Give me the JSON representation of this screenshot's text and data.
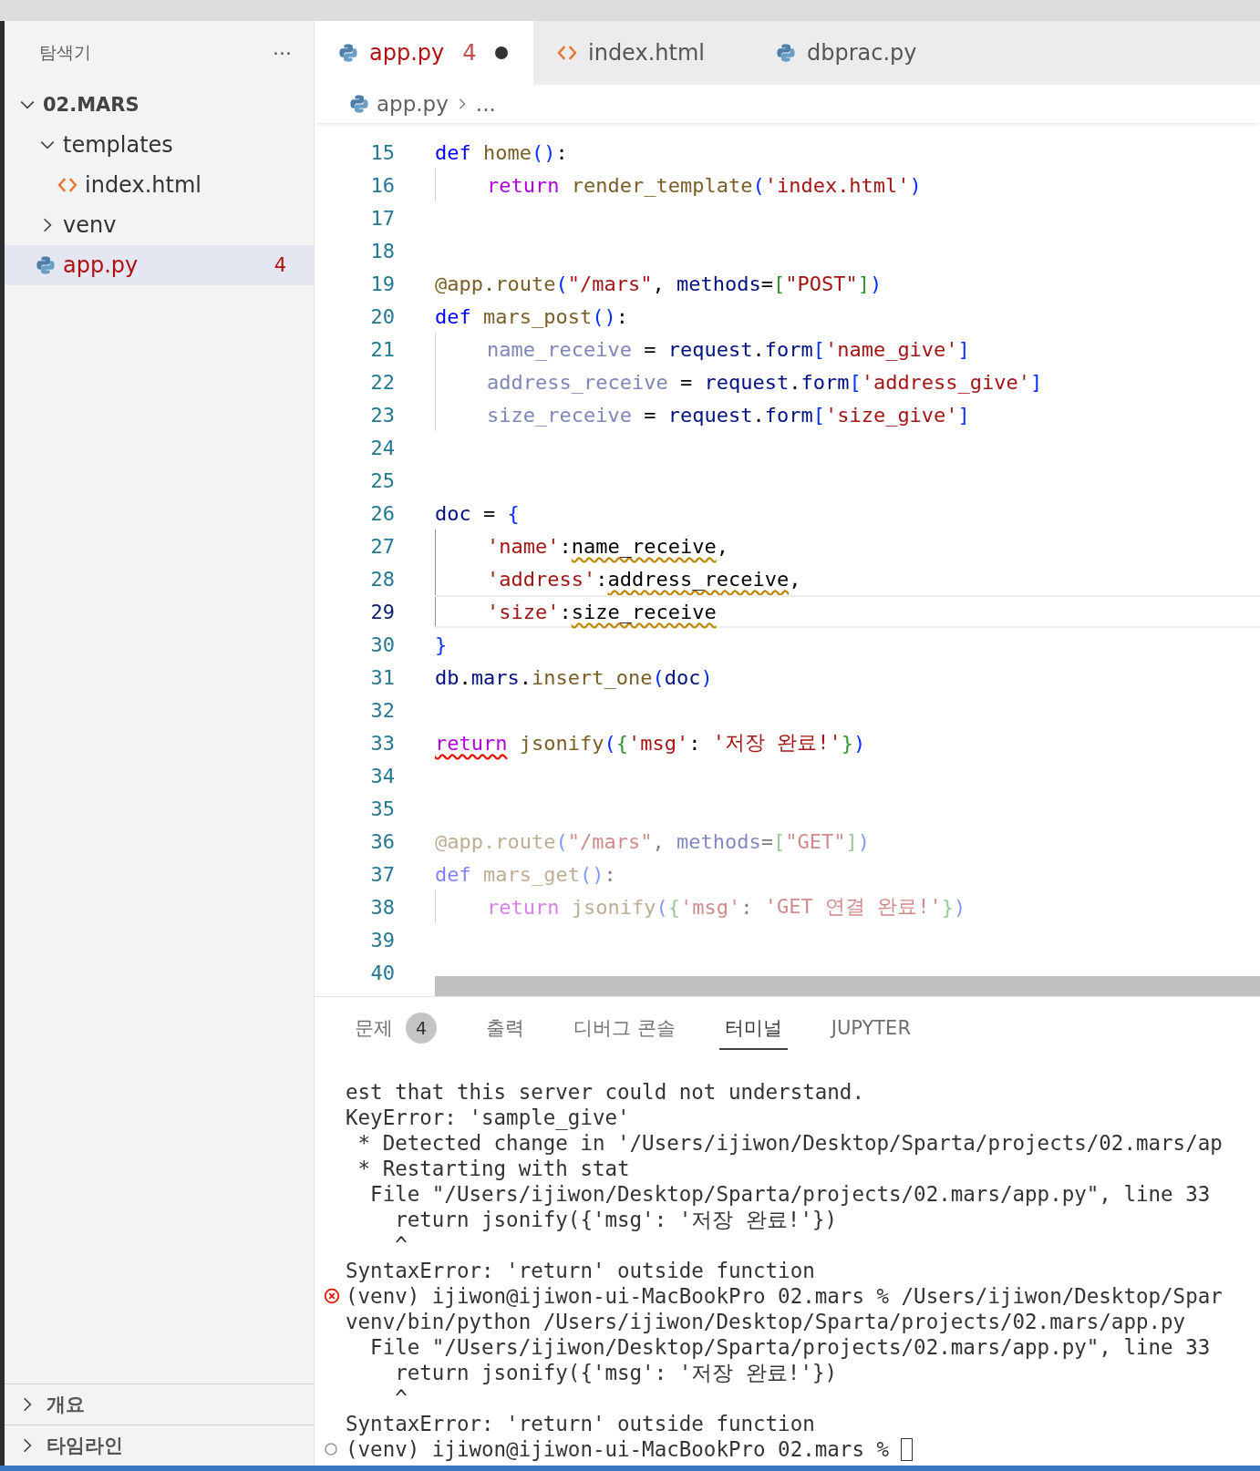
{
  "sidebar": {
    "title": "탐색기",
    "more": "···",
    "folder": {
      "name": "02.MARS",
      "expanded": true
    },
    "tree": [
      {
        "name": "templates",
        "kind": "folder",
        "expanded": true,
        "selected": false,
        "children": [
          {
            "name": "index.html",
            "kind": "html",
            "selected": false
          }
        ]
      },
      {
        "name": "venv",
        "kind": "folder",
        "expanded": false,
        "selected": false
      },
      {
        "name": "app.py",
        "kind": "python",
        "selected": true,
        "error": true,
        "badge": "4"
      }
    ],
    "sections": [
      {
        "name": "개요",
        "expanded": false
      },
      {
        "name": "타임라인",
        "expanded": false
      }
    ]
  },
  "tabs": [
    {
      "label": "app.py",
      "kind": "python",
      "selected": true,
      "error": true,
      "badge": "4",
      "modified": true
    },
    {
      "label": "index.html",
      "kind": "html",
      "selected": false,
      "error": false,
      "modified": false
    },
    {
      "label": "dbprac.py",
      "kind": "python",
      "selected": false,
      "error": false,
      "modified": false
    }
  ],
  "breadcrumb": {
    "file": "app.py",
    "rest": "..."
  },
  "code_lines": [
    {
      "number": "15",
      "current": false,
      "faded": false,
      "tokens": [
        {
          "text": "def ",
          "kind": "keyword"
        },
        {
          "text": "home",
          "kind": "function"
        },
        {
          "text": "()",
          "kind": "bracket"
        },
        {
          "text": ":",
          "kind": "plain"
        }
      ]
    },
    {
      "number": "16",
      "current": false,
      "faded": false,
      "indented": true,
      "guide_active": false,
      "tokens": [
        {
          "text": "return ",
          "kind": "control"
        },
        {
          "text": "render_template",
          "kind": "function"
        },
        {
          "text": "(",
          "kind": "bracket"
        },
        {
          "text": "'index.html'",
          "kind": "string"
        },
        {
          "text": ")",
          "kind": "bracket"
        }
      ]
    },
    {
      "number": "17",
      "current": false
    },
    {
      "number": "18",
      "current": false
    },
    {
      "number": "19",
      "current": false,
      "faded": false,
      "tokens": [
        {
          "text": "@app.",
          "kind": "decorator"
        },
        {
          "text": "route",
          "kind": "function"
        },
        {
          "text": "(",
          "kind": "bracket"
        },
        {
          "text": "\"/mars\"",
          "kind": "string"
        },
        {
          "text": ", ",
          "kind": "plain"
        },
        {
          "text": "methods",
          "kind": "name"
        },
        {
          "text": "=",
          "kind": "plain"
        },
        {
          "text": "[",
          "kind": "bracket2"
        },
        {
          "text": "\"POST\"",
          "kind": "string"
        },
        {
          "text": "]",
          "kind": "bracket2"
        },
        {
          "text": ")",
          "kind": "bracket"
        }
      ]
    },
    {
      "number": "20",
      "current": false,
      "faded": false,
      "tokens": [
        {
          "text": "def ",
          "kind": "keyword"
        },
        {
          "text": "mars_post",
          "kind": "function"
        },
        {
          "text": "()",
          "kind": "bracket"
        },
        {
          "text": ":",
          "kind": "plain"
        }
      ]
    },
    {
      "number": "21",
      "current": false,
      "faded": false,
      "indented": true,
      "guide_active": false,
      "tokens": [
        {
          "text": "name_receive",
          "kind": "unused"
        },
        {
          "text": " = ",
          "kind": "plain"
        },
        {
          "text": "request",
          "kind": "name"
        },
        {
          "text": ".",
          "kind": "plain"
        },
        {
          "text": "form",
          "kind": "name"
        },
        {
          "text": "[",
          "kind": "bracket"
        },
        {
          "text": "'name_give'",
          "kind": "string"
        },
        {
          "text": "]",
          "kind": "bracket"
        }
      ]
    },
    {
      "number": "22",
      "current": false,
      "faded": false,
      "indented": true,
      "guide_active": false,
      "tokens": [
        {
          "text": "address_receive",
          "kind": "unused"
        },
        {
          "text": " = ",
          "kind": "plain"
        },
        {
          "text": "request",
          "kind": "name"
        },
        {
          "text": ".",
          "kind": "plain"
        },
        {
          "text": "form",
          "kind": "name"
        },
        {
          "text": "[",
          "kind": "bracket"
        },
        {
          "text": "'address_give'",
          "kind": "string"
        },
        {
          "text": "]",
          "kind": "bracket"
        }
      ]
    },
    {
      "number": "23",
      "current": false,
      "faded": false,
      "indented": true,
      "guide_active": false,
      "tokens": [
        {
          "text": "size_receive",
          "kind": "unused"
        },
        {
          "text": " = ",
          "kind": "plain"
        },
        {
          "text": "request",
          "kind": "name"
        },
        {
          "text": ".",
          "kind": "plain"
        },
        {
          "text": "form",
          "kind": "name"
        },
        {
          "text": "[",
          "kind": "bracket"
        },
        {
          "text": "'size_give'",
          "kind": "string"
        },
        {
          "text": "]",
          "kind": "bracket"
        }
      ]
    },
    {
      "number": "24",
      "current": false
    },
    {
      "number": "25",
      "current": false
    },
    {
      "number": "26",
      "current": false,
      "faded": false,
      "tokens": [
        {
          "text": "doc",
          "kind": "name"
        },
        {
          "text": " = ",
          "kind": "plain"
        },
        {
          "text": "{",
          "kind": "bracket"
        }
      ]
    },
    {
      "number": "27",
      "current": false,
      "faded": false,
      "indented": true,
      "guide_active": true,
      "tokens": [
        {
          "text": "'name'",
          "kind": "string"
        },
        {
          "text": ":",
          "kind": "plain"
        },
        {
          "text": "name_receive",
          "kind": "plain",
          "warning": true
        },
        {
          "text": ",",
          "kind": "plain"
        }
      ]
    },
    {
      "number": "28",
      "current": false,
      "faded": false,
      "indented": true,
      "guide_active": true,
      "tokens": [
        {
          "text": "'address'",
          "kind": "string"
        },
        {
          "text": ":",
          "kind": "plain"
        },
        {
          "text": "address_receive",
          "kind": "plain",
          "warning": true
        },
        {
          "text": ",",
          "kind": "plain"
        }
      ]
    },
    {
      "number": "29",
      "current": true,
      "faded": false,
      "indented": true,
      "guide_active": true,
      "tokens": [
        {
          "text": "'size'",
          "kind": "string"
        },
        {
          "text": ":",
          "kind": "plain"
        },
        {
          "text": "size_receive",
          "kind": "plain",
          "warning": true
        }
      ]
    },
    {
      "number": "30",
      "current": false,
      "faded": false,
      "tokens": [
        {
          "text": "}",
          "kind": "bracket"
        }
      ]
    },
    {
      "number": "31",
      "current": false,
      "faded": false,
      "tokens": [
        {
          "text": "db",
          "kind": "name"
        },
        {
          "text": ".",
          "kind": "plain"
        },
        {
          "text": "mars",
          "kind": "name"
        },
        {
          "text": ".",
          "kind": "plain"
        },
        {
          "text": "insert_one",
          "kind": "function"
        },
        {
          "text": "(",
          "kind": "bracket"
        },
        {
          "text": "doc",
          "kind": "name"
        },
        {
          "text": ")",
          "kind": "bracket"
        }
      ]
    },
    {
      "number": "32",
      "current": false
    },
    {
      "number": "33",
      "current": false,
      "faded": false,
      "tokens": [
        {
          "text": "return",
          "kind": "control",
          "error": true
        },
        {
          "text": " jsonify",
          "kind": "function"
        },
        {
          "text": "(",
          "kind": "bracket"
        },
        {
          "text": "{",
          "kind": "bracket2"
        },
        {
          "text": "'msg'",
          "kind": "string"
        },
        {
          "text": ": ",
          "kind": "plain"
        },
        {
          "text": "'저장 완료!'",
          "kind": "string"
        },
        {
          "text": "}",
          "kind": "bracket2"
        },
        {
          "text": ")",
          "kind": "bracket"
        }
      ]
    },
    {
      "number": "34",
      "current": false
    },
    {
      "number": "35",
      "current": false
    },
    {
      "number": "36",
      "current": false,
      "faded": true,
      "tokens": [
        {
          "text": "@app.",
          "kind": "decorator"
        },
        {
          "text": "route",
          "kind": "function"
        },
        {
          "text": "(",
          "kind": "bracket"
        },
        {
          "text": "\"/mars\"",
          "kind": "string"
        },
        {
          "text": ", ",
          "kind": "plain"
        },
        {
          "text": "methods",
          "kind": "name"
        },
        {
          "text": "=",
          "kind": "plain"
        },
        {
          "text": "[",
          "kind": "bracket2"
        },
        {
          "text": "\"GET\"",
          "kind": "string"
        },
        {
          "text": "]",
          "kind": "bracket2"
        },
        {
          "text": ")",
          "kind": "bracket"
        }
      ]
    },
    {
      "number": "37",
      "current": false,
      "faded": true,
      "tokens": [
        {
          "text": "def ",
          "kind": "keyword"
        },
        {
          "text": "mars_get",
          "kind": "function"
        },
        {
          "text": "()",
          "kind": "bracket"
        },
        {
          "text": ":",
          "kind": "plain"
        }
      ]
    },
    {
      "number": "38",
      "current": false,
      "faded": true,
      "indented": true,
      "guide_active": false,
      "tokens": [
        {
          "text": "return ",
          "kind": "control"
        },
        {
          "text": "jsonify",
          "kind": "function"
        },
        {
          "text": "(",
          "kind": "bracket"
        },
        {
          "text": "{",
          "kind": "bracket2"
        },
        {
          "text": "'msg'",
          "kind": "string"
        },
        {
          "text": ": ",
          "kind": "plain"
        },
        {
          "text": "'GET 연결 완료!'",
          "kind": "string"
        },
        {
          "text": "}",
          "kind": "bracket2"
        },
        {
          "text": ")",
          "kind": "bracket"
        }
      ]
    },
    {
      "number": "39",
      "current": false
    },
    {
      "number": "40",
      "current": false
    }
  ],
  "panel": {
    "tabs": [
      {
        "label": "문제",
        "selected": false,
        "badge": "4"
      },
      {
        "label": "출력",
        "selected": false
      },
      {
        "label": "디버그 콘솔",
        "selected": false
      },
      {
        "label": "터미널",
        "selected": true
      },
      {
        "label": "JUPYTER",
        "selected": false
      }
    ],
    "terminal": [
      {
        "text": "est that this server could not understand.",
        "kind": "output"
      },
      {
        "text": "KeyError: 'sample_give'",
        "kind": "output"
      },
      {
        "text": " * Detected change in '/Users/ijiwon/Desktop/Sparta/projects/02.mars/ap",
        "kind": "output"
      },
      {
        "text": " * Restarting with stat",
        "kind": "output"
      },
      {
        "text": "  File \"/Users/ijiwon/Desktop/Sparta/projects/02.mars/app.py\", line 33",
        "kind": "output"
      },
      {
        "text": "    return jsonify({'msg': '저장 완료!'})",
        "kind": "output"
      },
      {
        "text": "    ^",
        "kind": "output"
      },
      {
        "text": "SyntaxError: 'return' outside function",
        "kind": "output"
      },
      {
        "text": "(venv) ijiwon@ijiwon-ui-MacBookPro 02.mars % /Users/ijiwon/Desktop/Spar",
        "kind": "failed"
      },
      {
        "text": "venv/bin/python /Users/ijiwon/Desktop/Sparta/projects/02.mars/app.py",
        "kind": "output"
      },
      {
        "text": "  File \"/Users/ijiwon/Desktop/Sparta/projects/02.mars/app.py\", line 33",
        "kind": "output"
      },
      {
        "text": "    return jsonify({'msg': '저장 완료!'})",
        "kind": "output"
      },
      {
        "text": "    ^",
        "kind": "output"
      },
      {
        "text": "SyntaxError: 'return' outside function",
        "kind": "output"
      },
      {
        "text": "(venv) ijiwon@ijiwon-ui-MacBookPro 02.mars %",
        "kind": "idle",
        "cursor": true
      }
    ]
  }
}
